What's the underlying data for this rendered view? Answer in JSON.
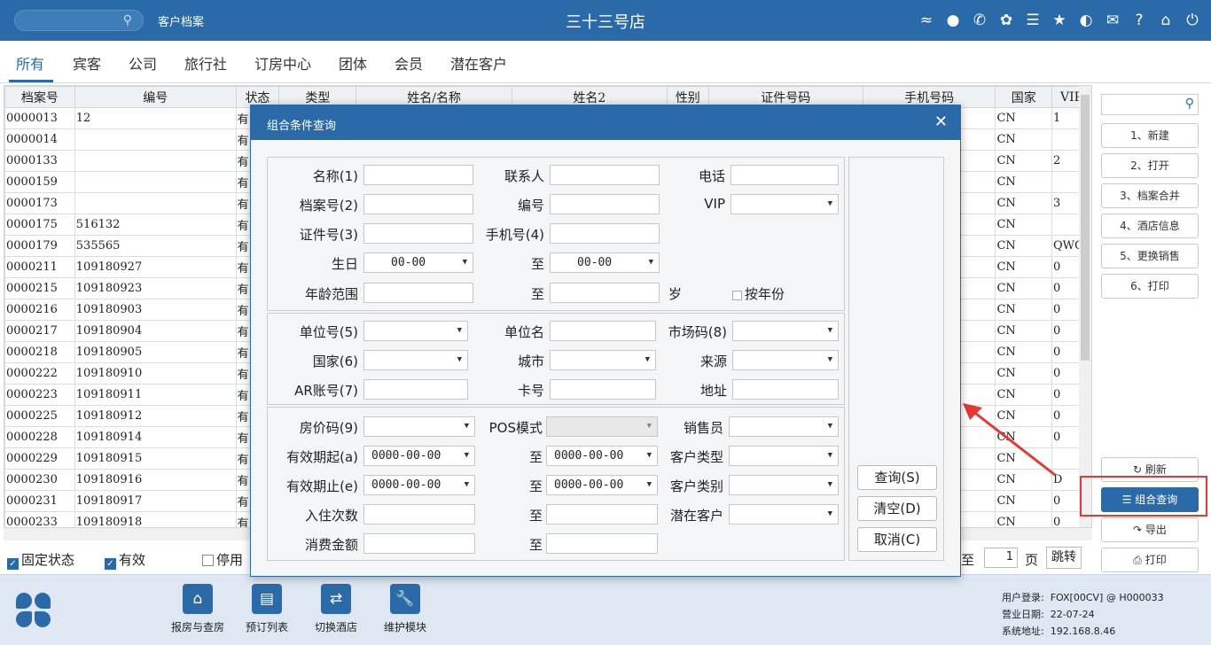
{
  "header": {
    "crumb": "客户档案",
    "store": "三十三号店"
  },
  "topicons": [
    "wifi-icon",
    "chat-icon",
    "phone-icon",
    "palette-icon",
    "menu-icon",
    "star-icon",
    "contrast-icon",
    "mail-icon",
    "help-icon",
    "home-icon",
    "power-icon"
  ],
  "tabs": [
    "所有",
    "宾客",
    "公司",
    "旅行社",
    "订房中心",
    "团体",
    "会员",
    "潜在客户"
  ],
  "columns": [
    "档案号",
    "编号",
    "状态",
    "类型",
    "姓名/名称",
    "姓名2",
    "性别",
    "证件号码",
    "手机号码",
    "国家",
    "VIP"
  ],
  "rows": [
    [
      "0000013",
      "12",
      "有",
      "CN",
      "1"
    ],
    [
      "0000014",
      "",
      "有",
      "CN",
      ""
    ],
    [
      "0000133",
      "",
      "有",
      "CN",
      "2"
    ],
    [
      "0000159",
      "",
      "有",
      "CN",
      ""
    ],
    [
      "0000173",
      "",
      "有",
      "CN",
      "3"
    ],
    [
      "0000175",
      "516132",
      "有",
      "CN",
      ""
    ],
    [
      "0000179",
      "535565",
      "有",
      "CN",
      "QWQ"
    ],
    [
      "0000211",
      "109180927",
      "有",
      "CN",
      "0"
    ],
    [
      "0000215",
      "109180923",
      "有",
      "CN",
      "0"
    ],
    [
      "0000216",
      "109180903",
      "有",
      "CN",
      "0"
    ],
    [
      "0000217",
      "109180904",
      "有",
      "CN",
      "0"
    ],
    [
      "0000218",
      "109180905",
      "有",
      "CN",
      "0"
    ],
    [
      "0000222",
      "109180910",
      "有",
      "CN",
      "0"
    ],
    [
      "0000223",
      "109180911",
      "有",
      "CN",
      "0"
    ],
    [
      "0000225",
      "109180912",
      "有",
      "CN",
      "0"
    ],
    [
      "0000228",
      "109180914",
      "有",
      "CN",
      "0"
    ],
    [
      "0000229",
      "109180915",
      "有",
      "CN",
      ""
    ],
    [
      "0000230",
      "109180916",
      "有",
      "CN",
      "D"
    ],
    [
      "0000231",
      "109180917",
      "有",
      "CN",
      "0"
    ],
    [
      "0000233",
      "109180918",
      "有",
      "CN",
      "0"
    ]
  ],
  "status": {
    "fixed": "固定状态",
    "valid": "有效",
    "disabled": "停用",
    "goto": "至",
    "page": "1",
    "page_unit": "页",
    "jump": "跳转"
  },
  "sidebar": {
    "buttons": [
      "1、新建",
      "2、打开",
      "3、档案合并",
      "4、酒店信息",
      "5、更换销售",
      "6、打印"
    ],
    "refresh": "刷新",
    "combo": "组合查询",
    "export": "导出",
    "print": "打印"
  },
  "footer": {
    "buttons": [
      "报房与查房",
      "预订列表",
      "切换酒店",
      "维护模块"
    ],
    "login_label": "用户登录:",
    "login": "FOX[00CV] @ H000033",
    "date_label": "营业日期:",
    "date": "22-07-24",
    "addr_label": "系统地址:",
    "addr": "192.168.8.46"
  },
  "dialog": {
    "title": "组合条件查询",
    "labels": {
      "name": "名称(1)",
      "contact": "联系人",
      "phone": "电话",
      "file_no": "档案号(2)",
      "code": "编号",
      "vip": "VIP",
      "id_no": "证件号(3)",
      "mobile": "手机号(4)",
      "birthday": "生日",
      "to": "至",
      "age": "年龄范围",
      "year_unit": "岁",
      "by_year": "按年份",
      "unit_no": "单位号(5)",
      "unit_name": "单位名",
      "market": "市场码(8)",
      "country": "国家(6)",
      "city": "城市",
      "source": "来源",
      "ar": "AR账号(7)",
      "card": "卡号",
      "address": "地址",
      "rate": "房价码(9)",
      "pos": "POS模式",
      "sales": "销售员",
      "valid_from": "有效期起(a)",
      "cust_type": "客户类型",
      "valid_to": "有效期止(e)",
      "cust_cat": "客户类别",
      "stays": "入住次数",
      "potential": "潜在客户",
      "spend": "消费金额"
    },
    "values": {
      "md": "00-00",
      "date": "0000-00-00"
    },
    "buttons": {
      "query": "查询(S)",
      "clear": "清空(D)",
      "cancel": "取消(C)"
    }
  }
}
